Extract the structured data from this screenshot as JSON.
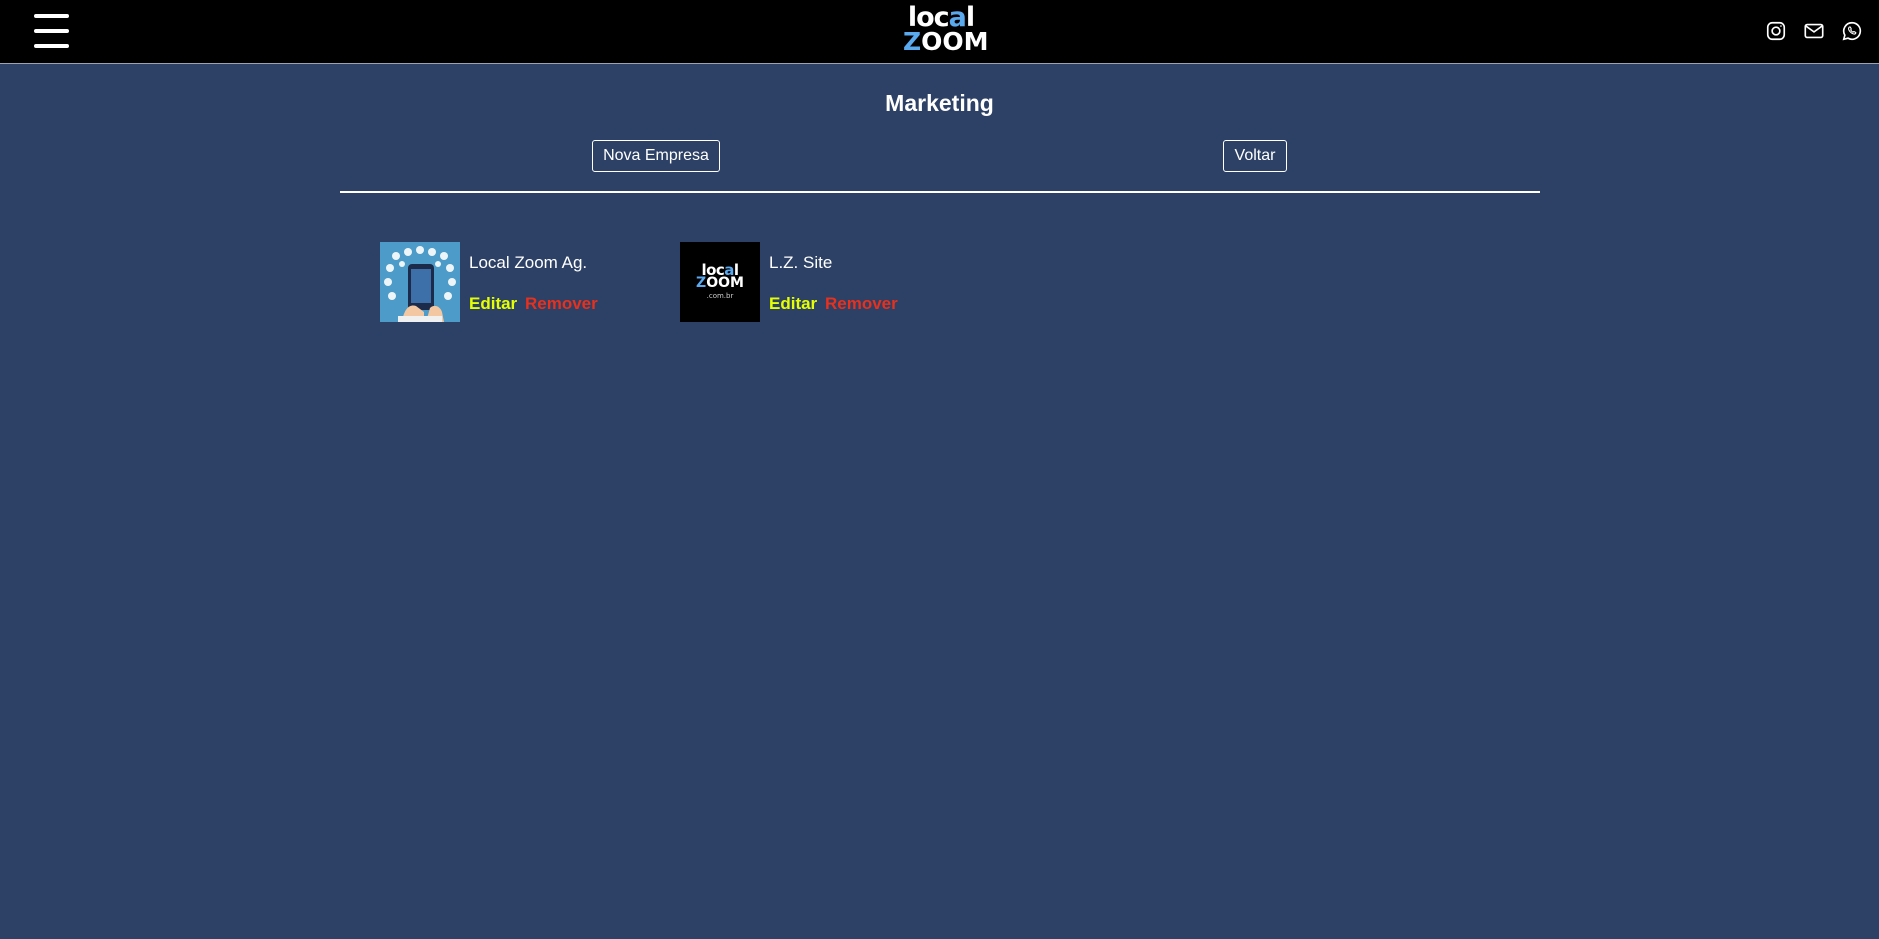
{
  "header": {
    "logo": {
      "line1_start": "loc",
      "line1_accent": "a",
      "line1_end": "l",
      "line2_accent": "Z",
      "line2_rest": "OOM"
    },
    "social_icons": [
      "instagram-icon",
      "mail-icon",
      "whatsapp-icon"
    ]
  },
  "page": {
    "title": "Marketing",
    "new_button_label": "Nova Empresa",
    "back_button_label": "Voltar"
  },
  "companies": [
    {
      "name": "Local Zoom Ag.",
      "edit_label": "Editar",
      "remove_label": "Remover",
      "thumbnail": "phone-apps-illustration"
    },
    {
      "name": "L.Z. Site",
      "edit_label": "Editar",
      "remove_label": "Remover",
      "thumbnail": "localzoom-logo-com-br"
    }
  ],
  "thumb_logo": {
    "line1_start": "loc",
    "line1_accent": "a",
    "line1_end": "l",
    "line2_accent": "Z",
    "line2_rest": "OOM",
    "line3": ".com.br"
  },
  "colors": {
    "background": "#2c4165",
    "topbar": "#000000",
    "accent_blue": "#5aa9ee",
    "edit": "#e6ff00",
    "remove": "#e8301c"
  }
}
